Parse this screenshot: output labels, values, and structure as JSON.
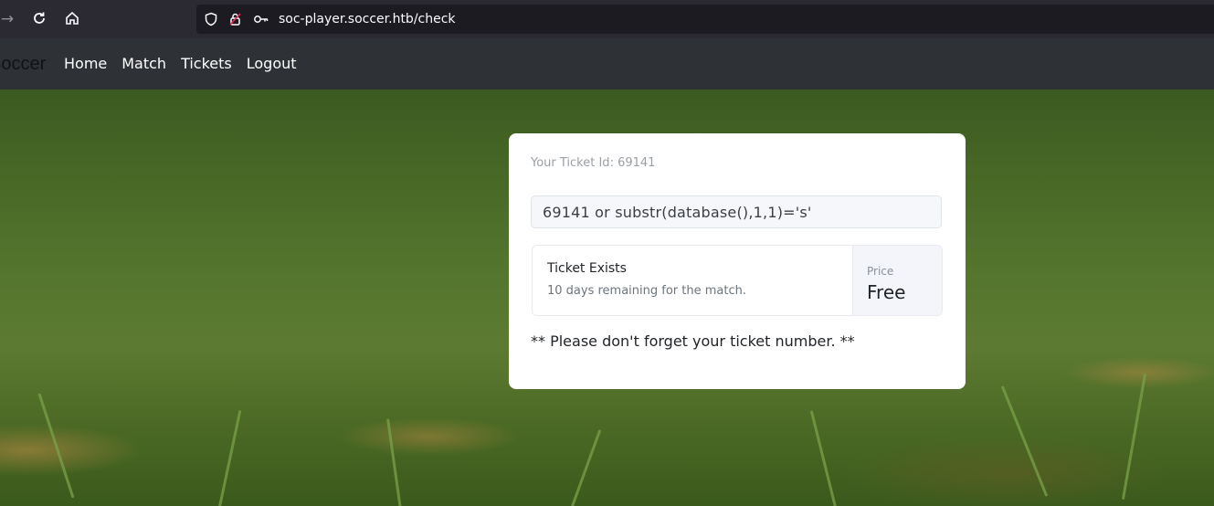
{
  "browser": {
    "url": "soc-player.soccer.htb/check"
  },
  "site": {
    "brand": "Soccer",
    "nav": [
      "Home",
      "Match",
      "Tickets",
      "Logout"
    ]
  },
  "ticket": {
    "id_label": "Your Ticket Id: 69141",
    "input_value": "69141 or substr(database(),1,1)='s'",
    "result_title": "Ticket Exists",
    "result_subtitle": "10 days remaining for the match.",
    "price_label": "Price",
    "price_value": "Free",
    "reminder": "** Please don't forget your ticket number. **"
  }
}
